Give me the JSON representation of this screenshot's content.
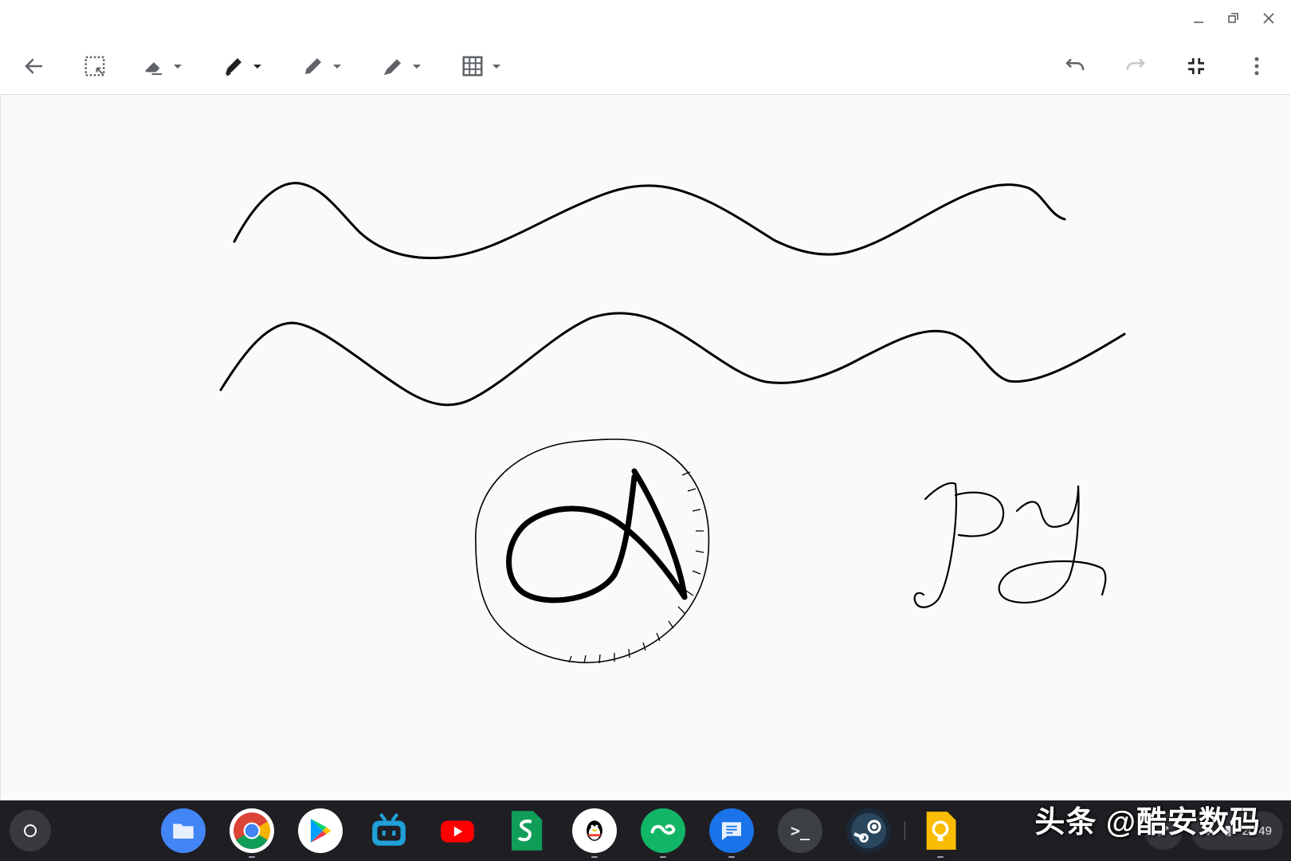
{
  "window": {
    "controls": [
      "minimize-icon",
      "restore-icon",
      "close-icon"
    ]
  },
  "toolbar": {
    "left_tools": [
      {
        "icon": "back-arrow-icon"
      },
      {
        "icon": "marquee-select-icon"
      },
      {
        "icon": "eraser-icon",
        "has_dropdown": true
      },
      {
        "icon": "marker-pen-icon",
        "has_dropdown": true,
        "active": true
      },
      {
        "icon": "pencil-icon",
        "has_dropdown": true
      },
      {
        "icon": "highlighter-icon",
        "has_dropdown": true
      },
      {
        "icon": "grid-background-icon",
        "has_dropdown": true
      }
    ],
    "right_tools": [
      {
        "icon": "undo-icon",
        "enabled": true
      },
      {
        "icon": "redo-icon",
        "enabled": false
      },
      {
        "icon": "exit-fullscreen-icon"
      },
      {
        "icon": "more-vert-icon"
      }
    ]
  },
  "canvas": {
    "background": "#fafafa",
    "ink_color": "#000000",
    "drawings": [
      "wavy-line-1",
      "wavy-line-2",
      "circled-logo-sketch",
      "handwritten-text"
    ],
    "handwritten_text": "PY"
  },
  "shelf": {
    "background": "#1f1e23",
    "apps": [
      {
        "name": "files-app",
        "icon": "files-icon",
        "color": "#4285f4"
      },
      {
        "name": "chrome-app",
        "icon": "chrome-icon",
        "color": "#ea4335"
      },
      {
        "name": "play-store-app",
        "icon": "play-store-icon",
        "color": "#34a853"
      },
      {
        "name": "bilibili-app",
        "icon": "bilibili-icon",
        "color": "#20a0d8"
      },
      {
        "name": "youtube-app",
        "icon": "youtube-icon",
        "color": "#ff0000"
      },
      {
        "name": "sheets-app",
        "icon": "sheets-icon",
        "color": "#0f9d58"
      },
      {
        "name": "qq-app",
        "icon": "qq-penguin-icon",
        "color": "#ffffff"
      },
      {
        "name": "coolapk-app",
        "icon": "coolapk-icon",
        "color": "#11b566"
      },
      {
        "name": "messages-app",
        "icon": "messages-icon",
        "color": "#1a73e8"
      },
      {
        "name": "terminal-app",
        "icon": "terminal-icon",
        "color": "#3c4043"
      },
      {
        "name": "steam-app",
        "icon": "steam-icon",
        "color": "#1b2838"
      },
      {
        "name": "keep-app",
        "icon": "keep-bulb-icon",
        "color": "#fbbc04"
      }
    ],
    "terminal_prompt": ">_",
    "tray_time": "20:49"
  },
  "watermark": {
    "text": "头条 @酷安数码"
  }
}
